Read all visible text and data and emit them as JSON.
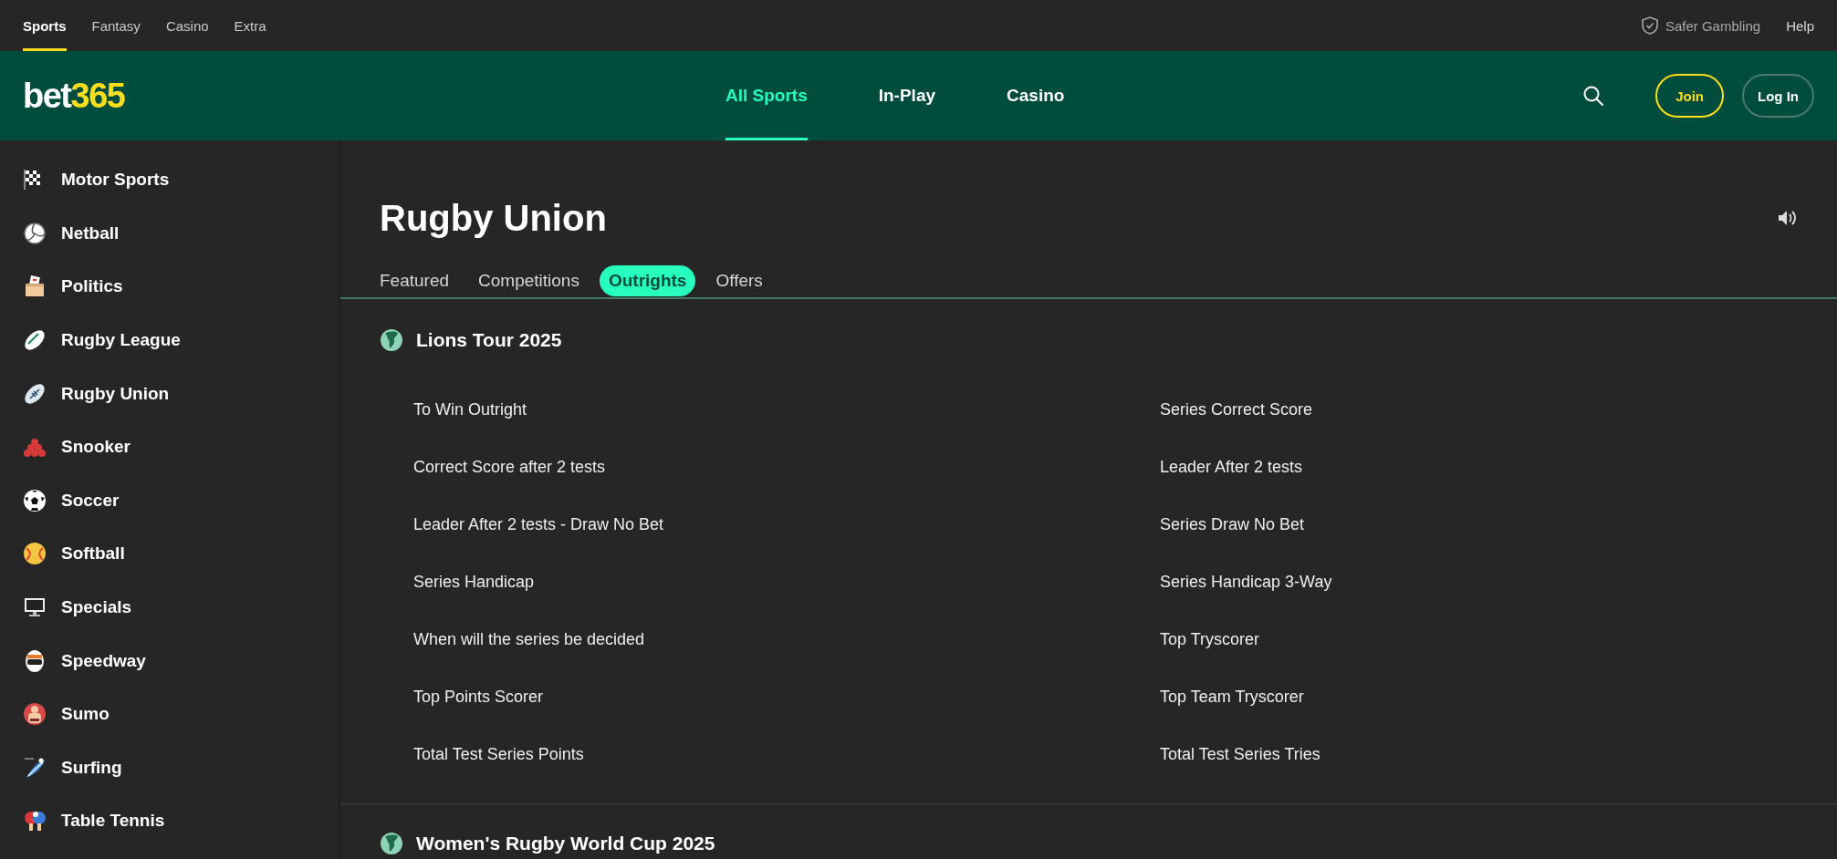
{
  "top_bar": {
    "links": [
      {
        "label": "Sports",
        "selected": true
      },
      {
        "label": "Fantasy",
        "selected": false
      },
      {
        "label": "Casino",
        "selected": false
      },
      {
        "label": "Extra",
        "selected": false
      }
    ],
    "safer_gambling": "Safer Gambling",
    "help": "Help"
  },
  "header": {
    "logo": {
      "main": "bet",
      "accent": "365"
    },
    "nav": [
      {
        "label": "All Sports",
        "selected": true
      },
      {
        "label": "In-Play",
        "selected": false
      },
      {
        "label": "Casino",
        "selected": false
      }
    ],
    "join": "Join",
    "login": "Log In"
  },
  "sidebar": {
    "items": [
      {
        "label": "Motor Sports"
      },
      {
        "label": "Netball"
      },
      {
        "label": "Politics"
      },
      {
        "label": "Rugby League"
      },
      {
        "label": "Rugby Union"
      },
      {
        "label": "Snooker"
      },
      {
        "label": "Soccer"
      },
      {
        "label": "Softball"
      },
      {
        "label": "Specials"
      },
      {
        "label": "Speedway"
      },
      {
        "label": "Sumo"
      },
      {
        "label": "Surfing"
      },
      {
        "label": "Table Tennis"
      }
    ]
  },
  "page": {
    "title": "Rugby Union",
    "tabs": [
      {
        "label": "Featured",
        "selected": false
      },
      {
        "label": "Competitions",
        "selected": false
      },
      {
        "label": "Outrights",
        "selected": true
      },
      {
        "label": "Offers",
        "selected": false
      }
    ]
  },
  "sections": [
    {
      "title": "Lions Tour 2025",
      "markets": [
        "To Win Outright",
        "Series Correct Score",
        "Correct Score after 2 tests",
        "Leader After 2 tests",
        "Leader After 2 tests - Draw No Bet",
        "Series Draw No Bet",
        "Series Handicap",
        "Series Handicap 3-Way",
        "When will the series be decided",
        "Top Tryscorer",
        "Top Points Scorer",
        "Top Team Tryscorer",
        "Total Test Series Points",
        "Total Test Series Tries"
      ]
    },
    {
      "title": "Women's Rugby World Cup 2025"
    }
  ]
}
